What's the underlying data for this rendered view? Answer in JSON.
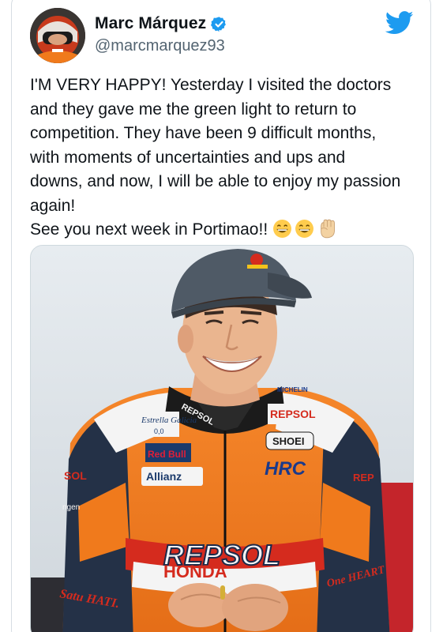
{
  "tweet": {
    "author": {
      "display_name": "Marc Márquez",
      "handle": "@marcmarquez93",
      "verified": true
    },
    "text_lines": [
      "I'M VERY HAPPY! Yesterday I visited the doctors",
      "and they gave me the green light to return to",
      "competition. They have been 9 difficult months,",
      "with moments of uncertainties and ups and",
      "downs, and now, I will be able to enjoy my passion",
      "again!",
      "See you next week in Portimao!!"
    ],
    "emojis": [
      "grinning-face-emoji",
      "grinning-face-emoji",
      "raised-fist-emoji"
    ],
    "media": {
      "suit_labels": {
        "repsol_large": "REPSOL",
        "repsol_chest": "REPSOL",
        "repsol_collar": "REPSOL",
        "repsol_left_arm": "SOL",
        "repsol_right_arm": "REP",
        "estrella_galicia": "Estrella Galicia",
        "estrella_sub": "0,0",
        "redbull": "Red Bull",
        "allianz": "Allianz",
        "shoei": "SHOEI",
        "hrc": "HRC",
        "honda": "HONDA",
        "michelin": "MICHELIN",
        "satu_hati": "Satu HATI.",
        "one_heart": "One HEART",
        "cap_logo": "Red Bull",
        "ngen": "ngen"
      }
    }
  },
  "colors": {
    "twitter_blue": "#1d9bf0",
    "repsol_orange": "#f07a1c",
    "repsol_red": "#d52b1e",
    "text_primary": "#0f1419",
    "text_secondary": "#536471"
  },
  "icons": {
    "logo": "twitter-bird-icon",
    "verified": "verified-badge-icon"
  }
}
